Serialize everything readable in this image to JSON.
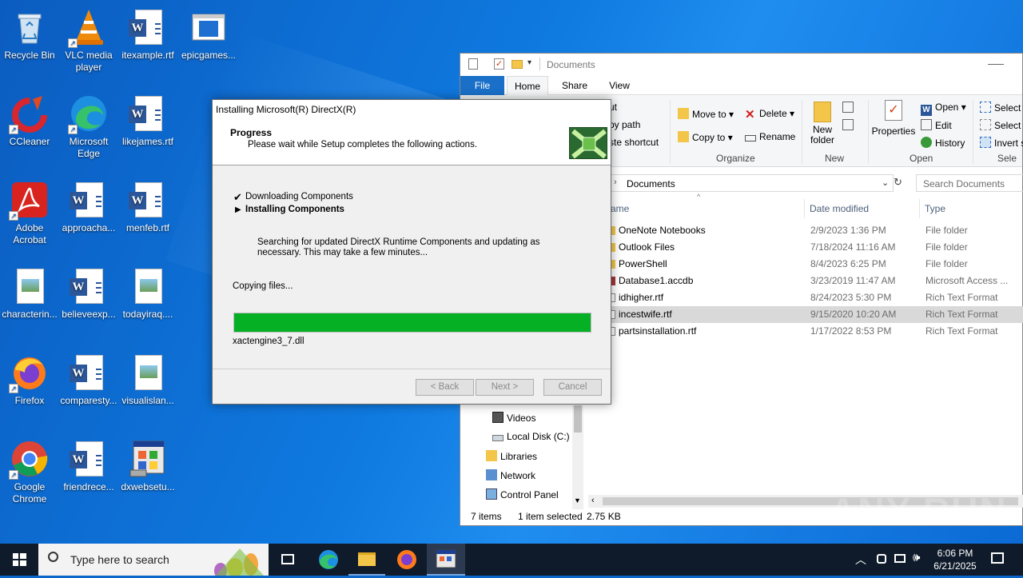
{
  "desktop": {
    "icons": [
      {
        "label": "Recycle Bin",
        "icon": "recycle-bin-icon"
      },
      {
        "label": "VLC media player",
        "icon": "vlc-icon"
      },
      {
        "label": "itexample.rtf",
        "icon": "word-doc-icon"
      },
      {
        "label": "epicgames...",
        "icon": "window-icon"
      },
      {
        "label": "CCleaner",
        "icon": "ccleaner-icon"
      },
      {
        "label": "Microsoft Edge",
        "icon": "edge-icon"
      },
      {
        "label": "likejames.rtf",
        "icon": "word-doc-icon"
      },
      {
        "label": "Adobe Acrobat",
        "icon": "acrobat-icon"
      },
      {
        "label": "approacha...",
        "icon": "word-doc-icon"
      },
      {
        "label": "menfeb.rtf",
        "icon": "word-doc-icon"
      },
      {
        "label": "characterin...",
        "icon": "image-doc-icon"
      },
      {
        "label": "believeexp...",
        "icon": "word-doc-icon"
      },
      {
        "label": "todayiraq....",
        "icon": "image-doc-icon"
      },
      {
        "label": "Firefox",
        "icon": "firefox-icon"
      },
      {
        "label": "comparesty...",
        "icon": "word-doc-icon"
      },
      {
        "label": "visualislan...",
        "icon": "image-doc-icon"
      },
      {
        "label": "Google Chrome",
        "icon": "chrome-icon"
      },
      {
        "label": "friendrece...",
        "icon": "word-doc-icon"
      },
      {
        "label": "dxwebsetu...",
        "icon": "installer-icon"
      }
    ]
  },
  "dialog": {
    "title": "Installing Microsoft(R) DirectX(R)",
    "header_title": "Progress",
    "header_subtitle": "Please wait while Setup completes the following actions.",
    "step1": "Downloading Components",
    "step2": "Installing Components",
    "description": "Searching for updated DirectX Runtime Components and updating as necessary. This may take a few minutes...",
    "status": "Copying files...",
    "progress": 1.0,
    "current_file": "xactengine3_7.dll",
    "back": "< Back",
    "next": "Next >",
    "cancel": "Cancel"
  },
  "explorer": {
    "title": "Documents",
    "tabs": {
      "file": "File",
      "home": "Home",
      "share": "Share",
      "view": "View"
    },
    "ribbon": {
      "copy_path": "py path",
      "paste_shortcut": "ste shortcut",
      "cut": "ut",
      "move_to": "Move to",
      "copy_to": "Copy to",
      "delete": "Delete",
      "rename": "Rename",
      "new_folder": "New folder",
      "properties": "Properties",
      "open": "Open",
      "edit": "Edit",
      "history": "History",
      "select_all": "Select a",
      "select_none": "Select n",
      "invert": "Invert s",
      "group_organize": "Organize",
      "group_new": "New",
      "group_open": "Open",
      "group_select": "Sele"
    },
    "address": "Documents",
    "search_placeholder": "Search Documents",
    "columns": {
      "name": "ame",
      "date": "Date modified",
      "type": "Type"
    },
    "files": [
      {
        "name": "OneNote Notebooks",
        "date": "2/9/2023 1:36 PM",
        "type": "File folder"
      },
      {
        "name": "Outlook Files",
        "date": "7/18/2024 11:16 AM",
        "type": "File folder"
      },
      {
        "name": "PowerShell",
        "date": "8/4/2023 6:25 PM",
        "type": "File folder"
      },
      {
        "name": "Database1.accdb",
        "date": "3/23/2019 11:47 AM",
        "type": "Microsoft Access ..."
      },
      {
        "name": "idhigher.rtf",
        "date": "8/24/2023 5:30 PM",
        "type": "Rich Text Format"
      },
      {
        "name": "incestwife.rtf",
        "date": "9/15/2020 10:20 AM",
        "type": "Rich Text Format"
      },
      {
        "name": "partsinstallation.rtf",
        "date": "1/17/2022 8:53 PM",
        "type": "Rich Text Format"
      }
    ],
    "nav": [
      "Videos",
      "Local Disk (C:)",
      "Libraries",
      "Network",
      "Control Panel"
    ],
    "status_items": "7 items",
    "status_selected": "1 item selected",
    "status_size": "2.75 KB"
  },
  "taskbar": {
    "search_placeholder": "Type here to search",
    "time": "6:06 PM",
    "date": "6/21/2025"
  },
  "watermark": "ANY RUN"
}
